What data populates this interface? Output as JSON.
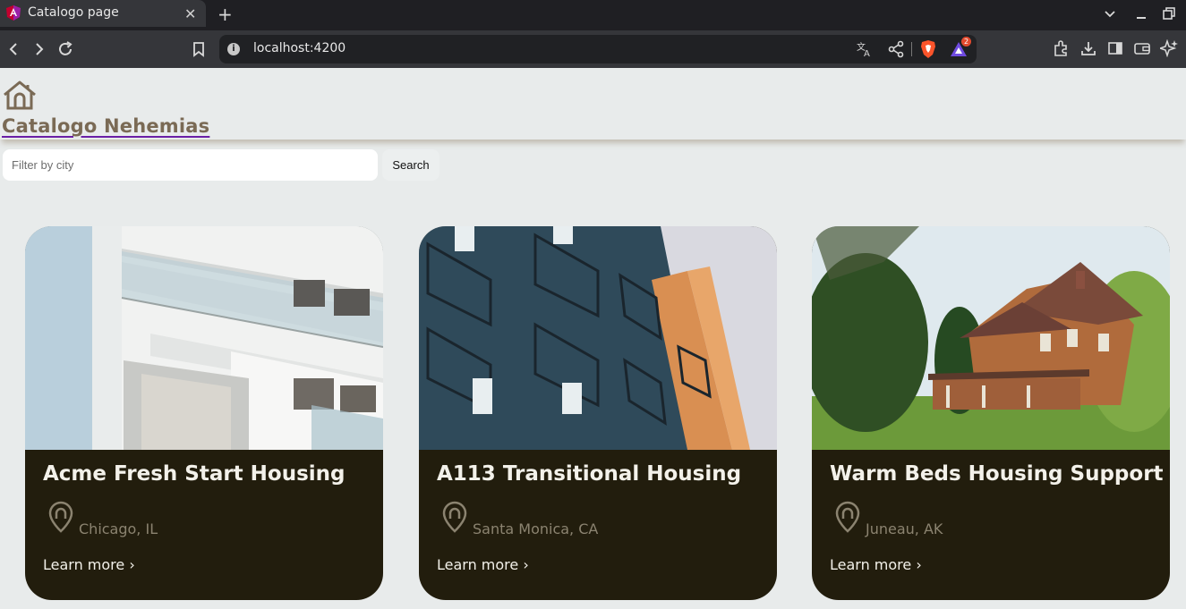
{
  "browser": {
    "tab_title": "Catalogo page",
    "tab_close": "✕",
    "new_tab": "+",
    "url": "localhost:4200",
    "shields_badge": "2"
  },
  "header": {
    "brand": "Catalogo Nehemias"
  },
  "search": {
    "placeholder": "Filter by city",
    "value": "",
    "button_label": "Search"
  },
  "listings": [
    {
      "name": "Acme Fresh Start Housing",
      "location": "Chicago, IL",
      "link": "Learn more ›"
    },
    {
      "name": "A113 Transitional Housing",
      "location": "Santa Monica, CA",
      "link": "Learn more ›"
    },
    {
      "name": "Warm Beds Housing Support",
      "location": "Juneau, AK",
      "link": "Learn more ›"
    }
  ],
  "colors": {
    "card_bg": "#221d0d",
    "brand_text": "#7a6a55",
    "link_underline": "#6a1fa6",
    "page_bg": "#e8ebeb"
  }
}
